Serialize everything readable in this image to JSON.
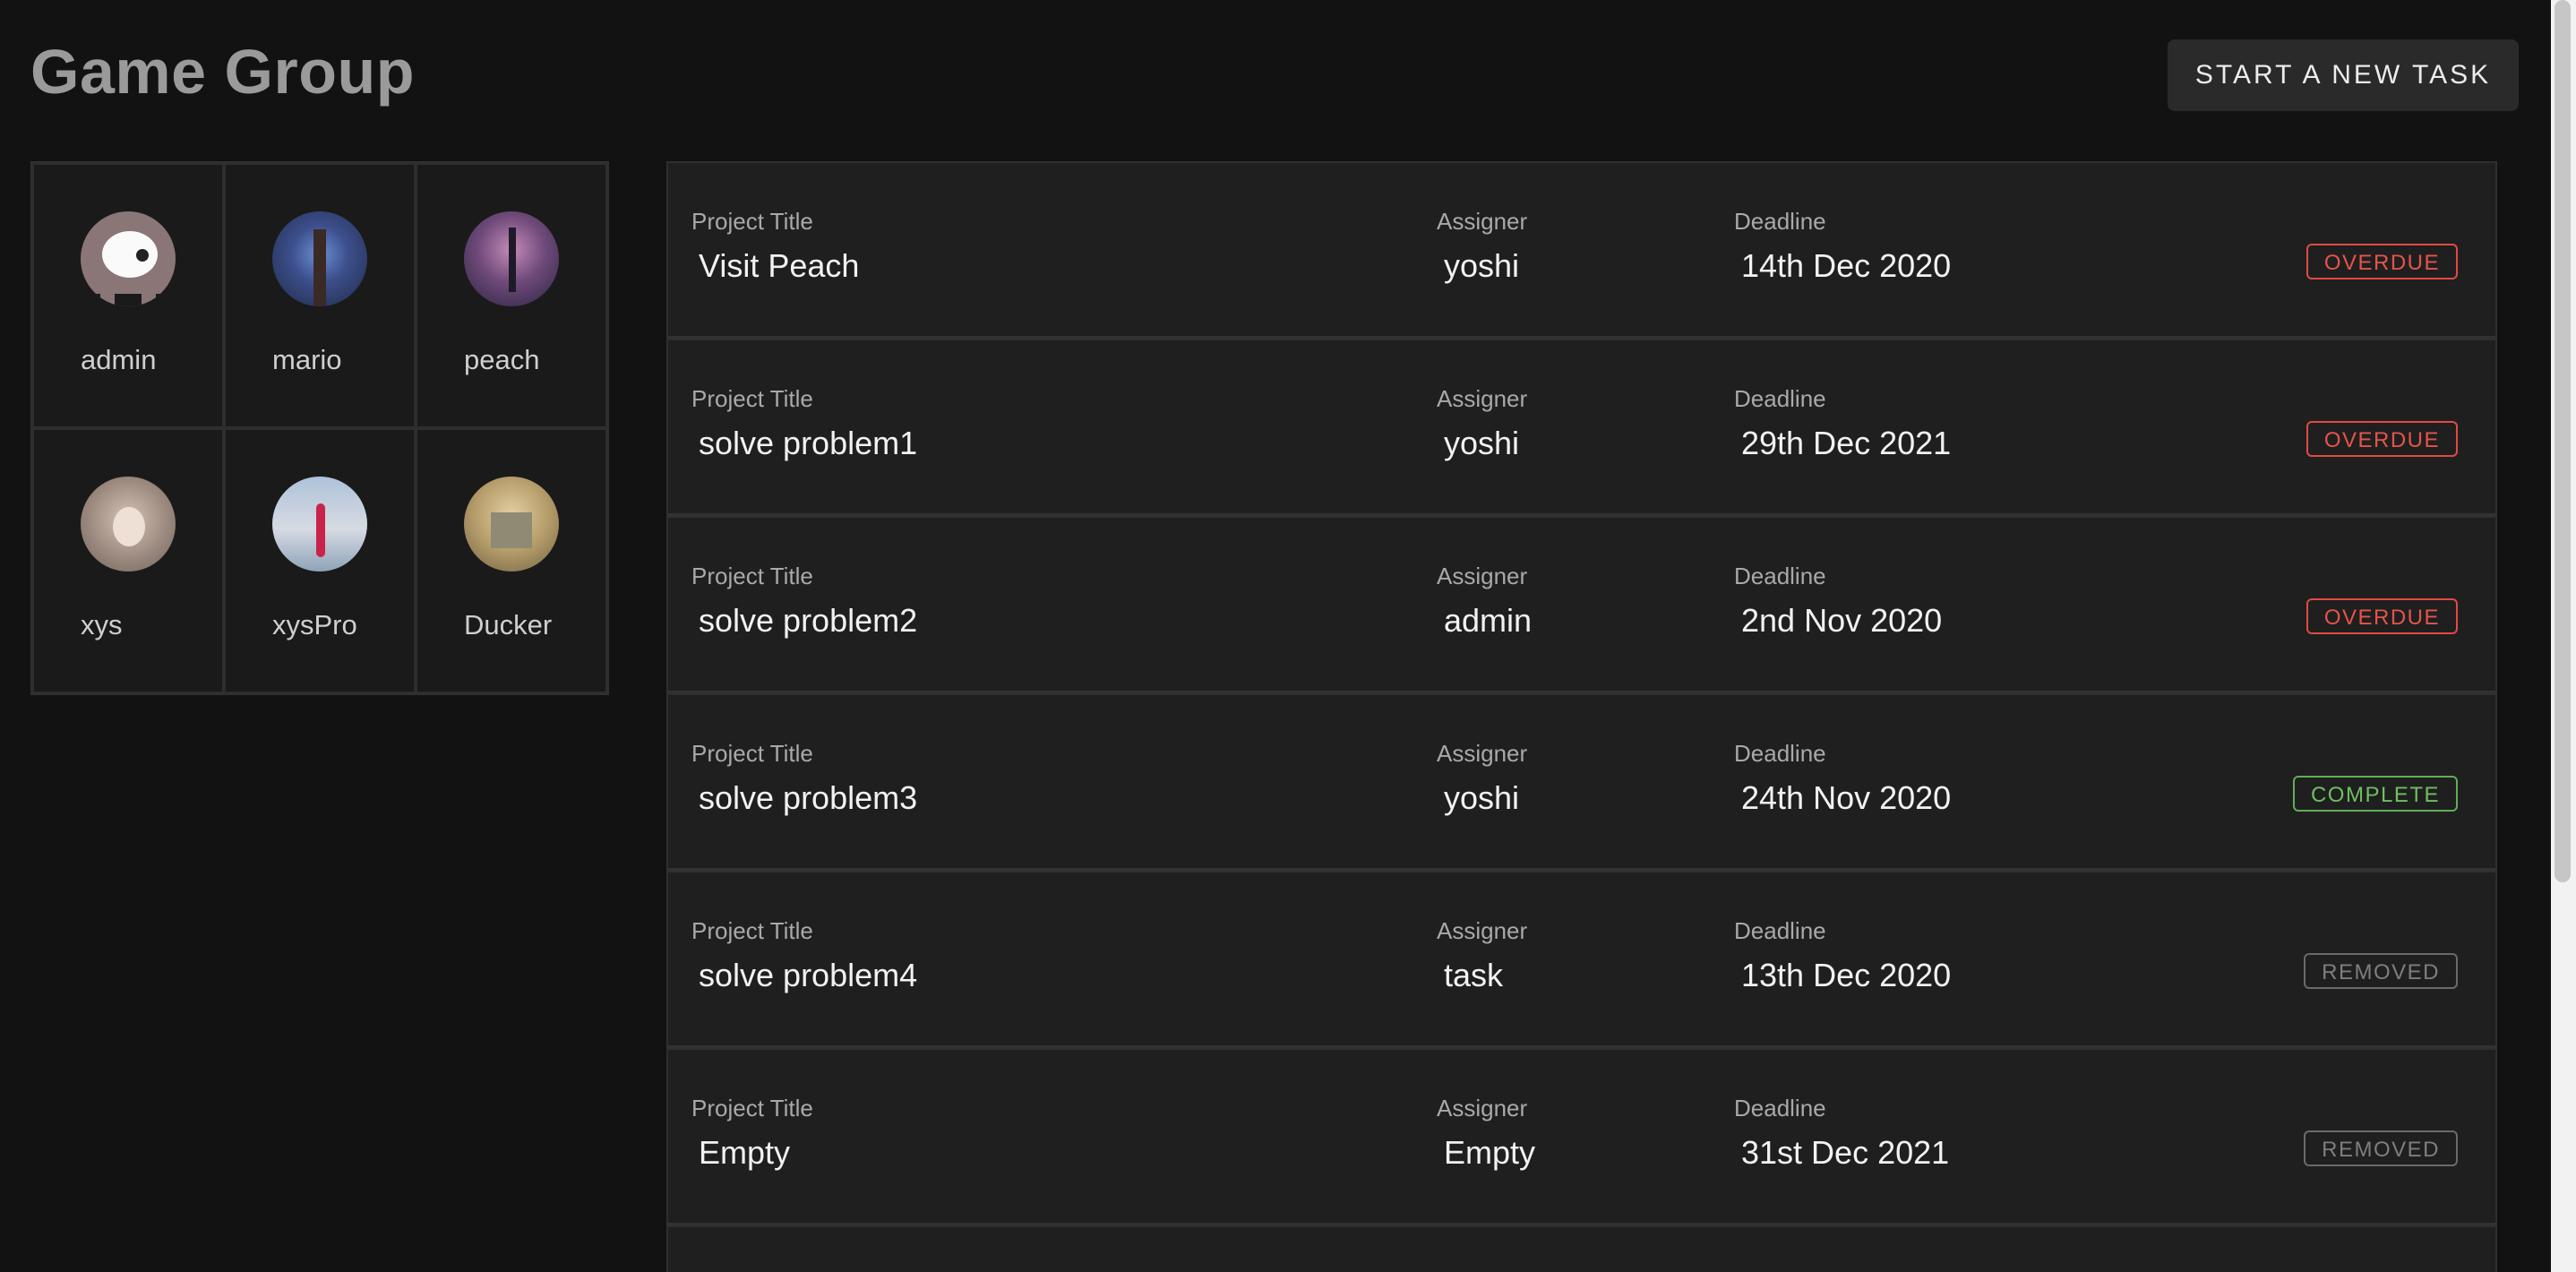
{
  "header": {
    "title": "Game Group",
    "new_task_label": "START A NEW TASK"
  },
  "members": [
    {
      "name": "admin"
    },
    {
      "name": "mario"
    },
    {
      "name": "peach"
    },
    {
      "name": "xys"
    },
    {
      "name": "xysPro"
    },
    {
      "name": "Ducker"
    }
  ],
  "columns": {
    "title": "Project Title",
    "assigner": "Assigner",
    "deadline": "Deadline"
  },
  "tasks": [
    {
      "title": "Visit Peach",
      "assigner": "yoshi",
      "deadline": "14th Dec 2020",
      "status": "OVERDUE"
    },
    {
      "title": "solve problem1",
      "assigner": "yoshi",
      "deadline": "29th Dec 2021",
      "status": "OVERDUE"
    },
    {
      "title": "solve problem2",
      "assigner": "admin",
      "deadline": "2nd Nov 2020",
      "status": "OVERDUE"
    },
    {
      "title": "solve problem3",
      "assigner": "yoshi",
      "deadline": "24th Nov 2020",
      "status": "COMPLETE"
    },
    {
      "title": "solve problem4",
      "assigner": "task",
      "deadline": "13th Dec 2020",
      "status": "REMOVED"
    },
    {
      "title": "Empty",
      "assigner": "Empty",
      "deadline": "31st Dec 2021",
      "status": "REMOVED"
    }
  ],
  "colors": {
    "overdue": "#e04a42",
    "complete": "#5fae57",
    "removed": "#6b7f8a"
  }
}
